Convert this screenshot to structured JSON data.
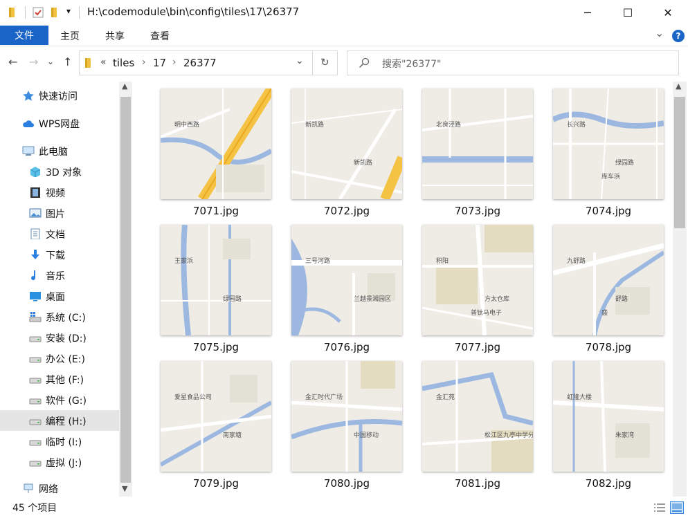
{
  "window": {
    "title": "H:\\codemodule\\bin\\config\\tiles\\17\\26377",
    "qat_dropdown": "▾",
    "minimize": "─",
    "maximize": "☐",
    "close": "✕"
  },
  "ribbon": {
    "file_tab": "文件",
    "tabs": [
      "主页",
      "共享",
      "查看"
    ],
    "help": "?",
    "expand": "⌄"
  },
  "address": {
    "back": "←",
    "forward": "→",
    "recent": "⌄",
    "up": "↑",
    "overflow": "«",
    "crumbs": [
      "tiles",
      "17",
      "26377"
    ],
    "sep": "›",
    "dropdown": "⌄",
    "refresh": "↻"
  },
  "search": {
    "placeholder": "搜索\"26377\""
  },
  "sidebar": {
    "items": [
      {
        "label": "快速访问",
        "icon": "star-icon"
      },
      {
        "label": "WPS网盘",
        "icon": "cloud-icon"
      },
      {
        "label": "此电脑",
        "icon": "computer-icon"
      },
      {
        "label": "3D 对象",
        "icon": "cube-icon"
      },
      {
        "label": "视频",
        "icon": "film-icon"
      },
      {
        "label": "图片",
        "icon": "picture-icon"
      },
      {
        "label": "文档",
        "icon": "document-icon"
      },
      {
        "label": "下载",
        "icon": "download-icon"
      },
      {
        "label": "音乐",
        "icon": "music-icon"
      },
      {
        "label": "桌面",
        "icon": "desktop-icon"
      },
      {
        "label": "系统 (C:)",
        "icon": "windows-drive-icon"
      },
      {
        "label": "安装 (D:)",
        "icon": "drive-icon"
      },
      {
        "label": "办公 (E:)",
        "icon": "drive-icon"
      },
      {
        "label": "其他 (F:)",
        "icon": "drive-icon"
      },
      {
        "label": "软件 (G:)",
        "icon": "drive-icon"
      },
      {
        "label": "编程 (H:)",
        "icon": "drive-icon",
        "selected": true
      },
      {
        "label": "临时 (I:)",
        "icon": "drive-icon"
      },
      {
        "label": "虚拟 (J:)",
        "icon": "drive-icon"
      },
      {
        "label": "网络",
        "icon": "network-icon"
      }
    ],
    "scroll_up": "▲",
    "scroll_down": "▼"
  },
  "files": [
    {
      "name": "7071.jpg",
      "labels": [
        "明中西路"
      ]
    },
    {
      "name": "7072.jpg",
      "labels": [
        "新凯路",
        "新凯路"
      ]
    },
    {
      "name": "7073.jpg",
      "labels": [
        "北良泾路"
      ]
    },
    {
      "name": "7074.jpg",
      "labels": [
        "长兴路",
        "绿园路",
        "库车浜"
      ]
    },
    {
      "name": "7075.jpg",
      "labels": [
        "王家浜",
        "绿园路"
      ]
    },
    {
      "name": "7076.jpg",
      "labels": [
        "三号河路",
        "兰越景湘园区"
      ]
    },
    {
      "name": "7077.jpg",
      "labels": [
        "积阳",
        "方太仓库",
        "普钛马电子"
      ]
    },
    {
      "name": "7078.jpg",
      "labels": [
        "九舒路",
        "舒路",
        "盛"
      ]
    },
    {
      "name": "7079.jpg",
      "labels": [
        "爱星食品公司",
        "南家塘"
      ]
    },
    {
      "name": "7080.jpg",
      "labels": [
        "金汇时代广场",
        "中国移动"
      ]
    },
    {
      "name": "7081.jpg",
      "labels": [
        "金汇苑",
        "松江区九亭中学分校"
      ]
    },
    {
      "name": "7082.jpg",
      "labels": [
        "虹隆大楼",
        "朱家湾"
      ]
    }
  ],
  "status": {
    "count": "45 个项目"
  },
  "colors": {
    "accent": "#1a64c8",
    "map_bg": "#efece6",
    "water": "#9cb8e0",
    "highway": "#f5c343",
    "road": "#ffffff"
  }
}
